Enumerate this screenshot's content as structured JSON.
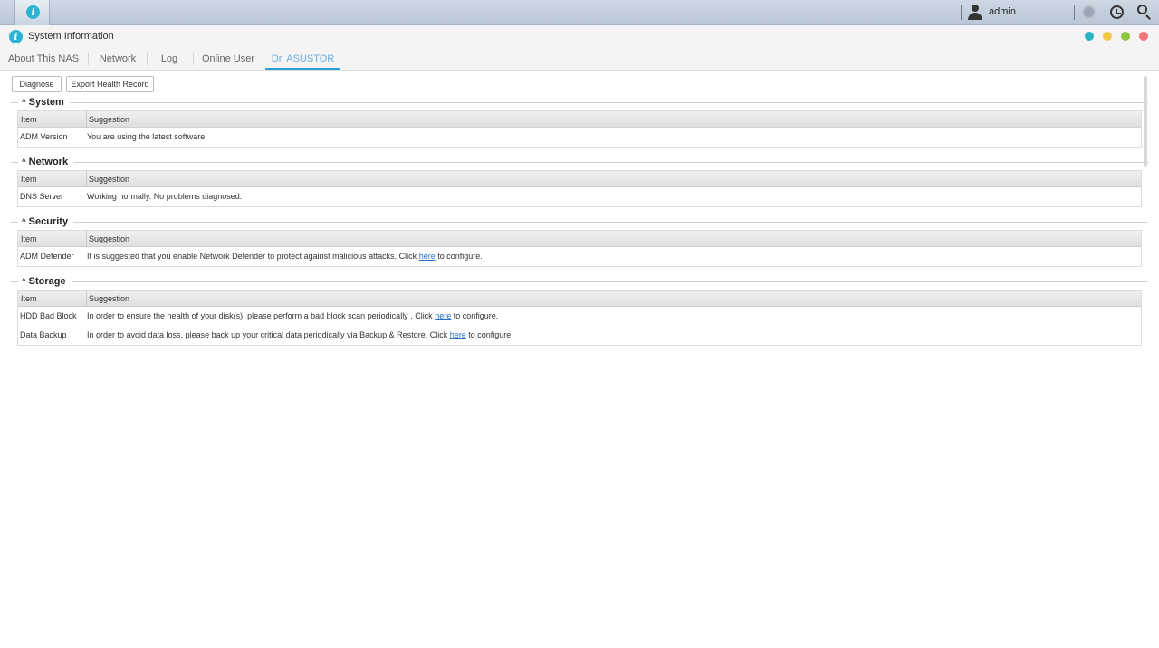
{
  "taskbar": {
    "user_name": "admin",
    "icons": [
      "info-icon",
      "user-icon",
      "notification-icon",
      "power-icon",
      "search-icon"
    ]
  },
  "window": {
    "title": "System Information",
    "controls_colors": [
      "#29b3bf",
      "#f3c646",
      "#8fc73e",
      "#f0767a"
    ]
  },
  "tabs": [
    {
      "label": "About This NAS"
    },
    {
      "label": "Network"
    },
    {
      "label": "Log"
    },
    {
      "label": "Online User"
    },
    {
      "label": "Dr. ASUSTOR",
      "active": true
    }
  ],
  "toolbar": {
    "diagnose_label": "Diagnose",
    "export_label": "Export Health Record"
  },
  "table_headers": {
    "item": "Item",
    "suggestion": "Suggestion"
  },
  "sections": [
    {
      "title": "System",
      "rows": [
        {
          "item": "ADM Version",
          "suggestion": "You are using the latest software"
        }
      ]
    },
    {
      "title": "Network",
      "rows": [
        {
          "item": "DNS Server",
          "suggestion": "Working normally. No problems diagnosed."
        }
      ]
    },
    {
      "title": "Security",
      "rows": [
        {
          "item": "ADM Defender",
          "suggestion_pre": "It is suggested that you enable Network Defender to protect against malicious attacks. Click ",
          "link": "here",
          "suggestion_post": " to configure."
        }
      ]
    },
    {
      "title": "Storage",
      "rows": [
        {
          "item": "HDD Bad Block",
          "suggestion_pre": "In order to ensure the health of your disk(s), please perform a bad block scan periodically . Click ",
          "link": "here",
          "suggestion_post": " to configure."
        },
        {
          "item": "Data Backup",
          "suggestion_pre": "In order to avoid data loss, please back up your critical data periodically via Backup & Restore. Click ",
          "link": "here",
          "suggestion_post": " to configure."
        }
      ]
    }
  ]
}
